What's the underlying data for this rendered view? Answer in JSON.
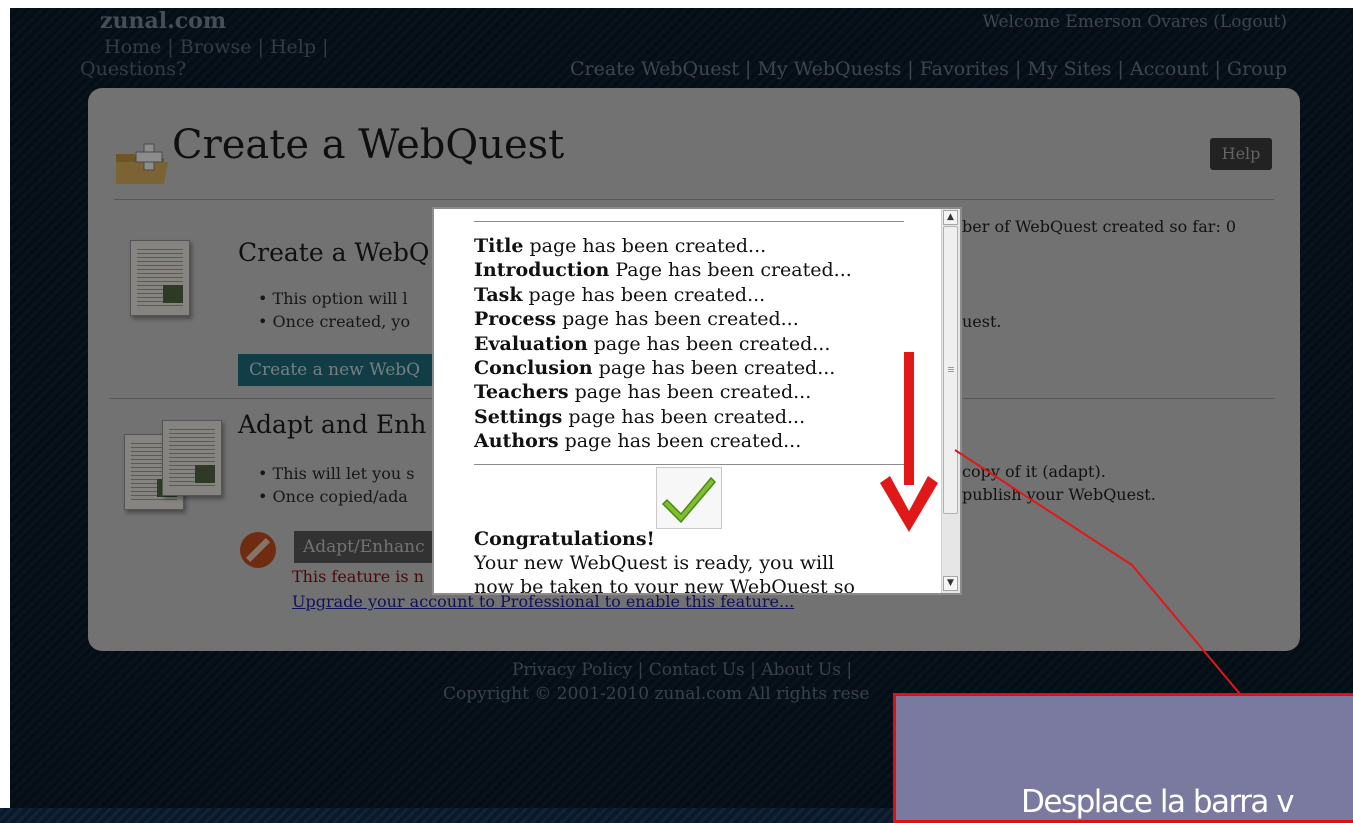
{
  "header": {
    "brand": "zunal.com",
    "top_nav": "Home | Browse | Help |",
    "questions": "Questions?",
    "welcome": "Welcome Emerson Ovares (Logout)",
    "right_nav": [
      "Create WebQuest",
      "My WebQuests",
      "Favorites",
      "My Sites",
      "Account",
      "Group"
    ]
  },
  "page": {
    "title": "Create a WebQuest",
    "help_button": "Help",
    "count_text": "ber of WebQuest created so far: 0",
    "sections": {
      "create": {
        "title": "Create a WebQ",
        "bullets": [
          "This option will l",
          "Once created, yo"
        ],
        "bullet_tail": "uest.",
        "button": "Create a new WebQ"
      },
      "adapt": {
        "title": "Adapt and Enh",
        "bullets": [
          "This will let you s",
          "Once copied/ada"
        ],
        "bullet_tails": [
          "copy of it (adapt).",
          "publish your WebQuest."
        ],
        "button": "Adapt/Enhanc",
        "warning": "This feature is n",
        "upgrade_link": "Upgrade your account to Professional to enable this feature..."
      }
    }
  },
  "modal": {
    "steps": [
      {
        "bold": "Title",
        "rest": " page has been created..."
      },
      {
        "bold": "Introduction",
        "rest": " Page has been created..."
      },
      {
        "bold": "Task",
        "rest": " page has been created..."
      },
      {
        "bold": "Process",
        "rest": " page has been created..."
      },
      {
        "bold": "Evaluation",
        "rest": " page has been created..."
      },
      {
        "bold": "Conclusion",
        "rest": " page has been created..."
      },
      {
        "bold": "Teachers",
        "rest": " page has been created..."
      },
      {
        "bold": "Settings",
        "rest": " page has been created..."
      },
      {
        "bold": "Authors",
        "rest": " page has been created..."
      }
    ],
    "congrats_bold": "Congratulations",
    "congrats_mark": "!",
    "congrats_line1": "Your new WebQuest is ready, you will",
    "congrats_line2": "now be taken to your new WebQuest so",
    "scroll_up": "▲",
    "scroll_down": "▼"
  },
  "footer": {
    "links": "Privacy Policy | Contact Us | About Us |",
    "copyright": "Copyright © 2001-2010 zunal.com All rights rese"
  },
  "annotation": {
    "callout_text": "Desplace la barra v",
    "arrow_color": "#e01818",
    "box_color": "#7a7aa0"
  }
}
